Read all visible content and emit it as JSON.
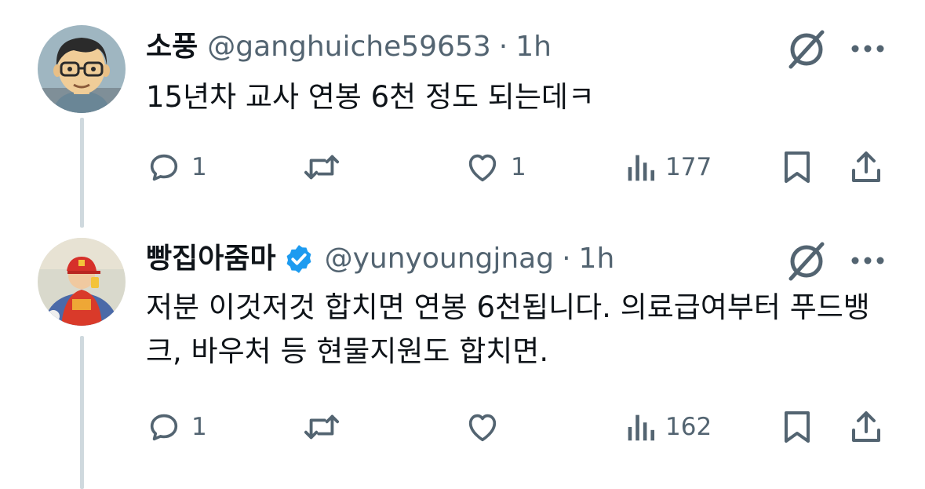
{
  "tweets": [
    {
      "name": "소풍",
      "handle": "@ganghuiche59653",
      "separator": "·",
      "time": "1h",
      "text": "15년차 교사 연봉 6천 정도 되는데ㅋ",
      "verified": false,
      "avatar": "cartoon-man-with-glasses",
      "counts": {
        "reply": "1",
        "retweet": "",
        "like": "1",
        "views": "177"
      }
    },
    {
      "name": "빵집아줌마",
      "handle": "@yunyoungjnag",
      "separator": "·",
      "time": "1h",
      "text": "저분 이것저것 합치면 연봉 6천됩니다. 의료급여부터 푸드뱅크, 바우처 등 현물지원도 합치면.",
      "verified": true,
      "avatar": "person-with-red-cap",
      "counts": {
        "reply": "1",
        "retweet": "",
        "like": "",
        "views": "162"
      }
    }
  ],
  "colors": {
    "text": "#0f1419",
    "secondary": "#536471",
    "verified": "#1d9bf0",
    "thread_line": "#cfd9de"
  },
  "icons": [
    "reply-icon",
    "retweet-icon",
    "like-icon",
    "views-icon",
    "bookmark-icon",
    "share-icon",
    "grok-icon",
    "more-icon",
    "verified-badge-icon"
  ]
}
